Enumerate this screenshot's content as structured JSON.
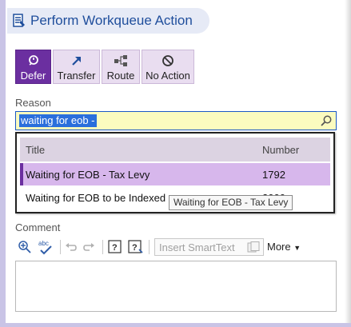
{
  "dialog": {
    "title": "Perform Workqueue Action"
  },
  "toolbar": {
    "defer_label": "Defer",
    "transfer_label": "Transfer",
    "route_label": "Route",
    "no_action_label": "No Action"
  },
  "reason": {
    "label": "Reason",
    "value": "waiting for eob -"
  },
  "dropdown": {
    "columns": [
      "Title",
      "Number"
    ],
    "rows": [
      {
        "title": "Waiting for EOB - Tax Levy",
        "number": "1792"
      },
      {
        "title": "Waiting for EOB to be Indexed",
        "number": "2000"
      }
    ]
  },
  "tooltip": {
    "text": "Waiting for EOB - Tax Levy"
  },
  "comment": {
    "label": "Comment",
    "smart_text_placeholder": "Insert SmartText",
    "more_label": "More"
  },
  "colors": {
    "accent": "#6b2fa0",
    "selected_row": "#d7b7ec",
    "title_text": "#1f4e9c",
    "input_bg": "#fbfbbf"
  }
}
